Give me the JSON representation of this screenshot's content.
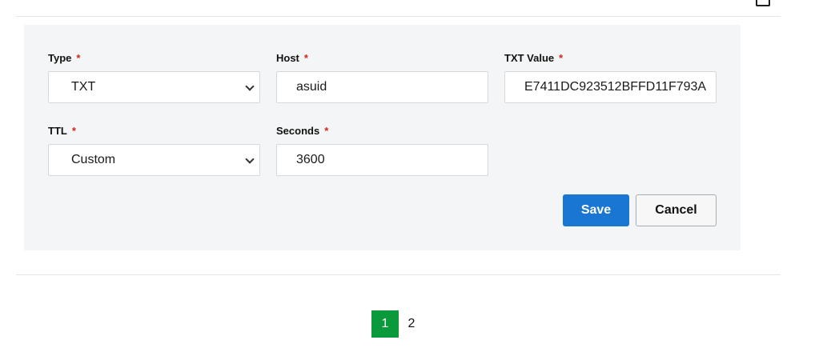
{
  "form": {
    "type": {
      "label": "Type",
      "required_mark": "*",
      "value": "TXT"
    },
    "host": {
      "label": "Host",
      "required_mark": "*",
      "value": "asuid"
    },
    "txt_value": {
      "label": "TXT Value",
      "required_mark": "*",
      "value": "E7411DC923512BFFD11F793A"
    },
    "ttl": {
      "label": "TTL",
      "required_mark": "*",
      "value": "Custom"
    },
    "seconds": {
      "label": "Seconds",
      "required_mark": "*",
      "value": "3600"
    }
  },
  "actions": {
    "save_label": "Save",
    "cancel_label": "Cancel"
  },
  "pagination": {
    "current": "1",
    "pages": [
      "1",
      "2"
    ]
  },
  "icons": {
    "top_right": "export-icon",
    "select_arrow": "chevron-down-icon"
  },
  "colors": {
    "primary": "#1976d2",
    "active_page": "#0a9a3c",
    "required": "#d0261b",
    "panel_bg": "#f4f5f6"
  }
}
